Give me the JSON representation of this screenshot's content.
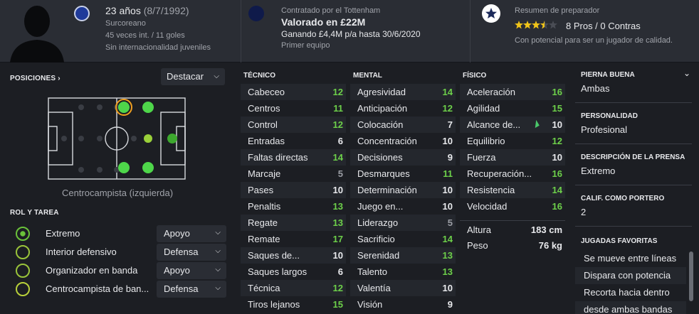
{
  "header": {
    "age_line": "23 años",
    "dob": "(8/7/1992)",
    "club": "Surcoreano",
    "caps_goals": "45 veces int. / 11 goles",
    "youth": "Sin internacionalidad juveniles",
    "contract_by": "Contratado por el Tottenham",
    "valued": "Valorado en £22M",
    "wage": "Ganando £4,4M p/a hasta 30/6/2020",
    "squad": "Primer equipo",
    "coach_title": "Resumen de preparador",
    "stars": 3.5,
    "pros_cons": "8 Pros / 0 Contras",
    "coach_note": "Con potencial para ser un jugador de calidad."
  },
  "positions": {
    "title": "POSICIONES",
    "title_arrow": "›",
    "highlight_label": "Destacar",
    "position_name": "Centrocampista (izquierda)"
  },
  "roles": {
    "title": "ROL Y TAREA",
    "items": [
      {
        "name": "Extremo",
        "duty": "Apoyo",
        "level": "full"
      },
      {
        "name": "Interior defensivo",
        "duty": "Defensa",
        "level": "partial"
      },
      {
        "name": "Organizador en banda",
        "duty": "Apoyo",
        "level": "partial"
      },
      {
        "name": "Centrocampista de ban...",
        "duty": "Defensa",
        "level": "partial"
      }
    ]
  },
  "attributes": {
    "tecnico": {
      "title": "TÉCNICO",
      "items": [
        {
          "name": "Cabeceo",
          "value": "12"
        },
        {
          "name": "Centros",
          "value": "11"
        },
        {
          "name": "Control",
          "value": "12"
        },
        {
          "name": "Entradas",
          "value": "6"
        },
        {
          "name": "Faltas directas",
          "value": "14"
        },
        {
          "name": "Marcaje",
          "value": "5"
        },
        {
          "name": "Pases",
          "value": "10"
        },
        {
          "name": "Penaltis",
          "value": "13"
        },
        {
          "name": "Regate",
          "value": "13"
        },
        {
          "name": "Remate",
          "value": "17"
        },
        {
          "name": "Saques de...",
          "value": "10"
        },
        {
          "name": "Saques largos",
          "value": "6"
        },
        {
          "name": "Técnica",
          "value": "12"
        },
        {
          "name": "Tiros lejanos",
          "value": "15"
        }
      ]
    },
    "mental": {
      "title": "MENTAL",
      "items": [
        {
          "name": "Agresividad",
          "value": "14"
        },
        {
          "name": "Anticipación",
          "value": "12"
        },
        {
          "name": "Colocación",
          "value": "7"
        },
        {
          "name": "Concentración",
          "value": "10"
        },
        {
          "name": "Decisiones",
          "value": "9"
        },
        {
          "name": "Desmarques",
          "value": "11"
        },
        {
          "name": "Determinación",
          "value": "10"
        },
        {
          "name": "Juego en...",
          "value": "10"
        },
        {
          "name": "Liderazgo",
          "value": "5"
        },
        {
          "name": "Sacrificio",
          "value": "14"
        },
        {
          "name": "Serenidad",
          "value": "13"
        },
        {
          "name": "Talento",
          "value": "13"
        },
        {
          "name": "Valentía",
          "value": "10"
        },
        {
          "name": "Visión",
          "value": "9"
        }
      ]
    },
    "fisico": {
      "title": "FÍSICO",
      "items": [
        {
          "name": "Aceleración",
          "value": "16"
        },
        {
          "name": "Agilidad",
          "value": "15"
        },
        {
          "name": "Alcance de...",
          "value": "10"
        },
        {
          "name": "Equilibrio",
          "value": "12"
        },
        {
          "name": "Fuerza",
          "value": "10"
        },
        {
          "name": "Recuperación...",
          "value": "16"
        },
        {
          "name": "Resistencia",
          "value": "14"
        },
        {
          "name": "Velocidad",
          "value": "16"
        }
      ]
    },
    "height_label": "Altura",
    "height_value": "183 cm",
    "weight_label": "Peso",
    "weight_value": "76 kg"
  },
  "details": {
    "foot_title": "PIERNA BUENA",
    "foot_value": "Ambas",
    "personality_title": "PERSONALIDAD",
    "personality_value": "Profesional",
    "press_title": "DESCRIPCIÓN DE LA PRENSA",
    "press_value": "Extremo",
    "gk_title": "CALIF. COMO PORTERO",
    "gk_value": "2",
    "moves_title": "JUGADAS FAVORITAS",
    "moves": [
      "Se mueve entre líneas",
      "Dispara con potencia",
      "Recorta hacia dentro",
      "desde ambas bandas"
    ]
  },
  "colors": {
    "bg": "#1c1e23",
    "panel": "#2a2d34",
    "green": "#6dd04a",
    "star": "#f0c419"
  }
}
